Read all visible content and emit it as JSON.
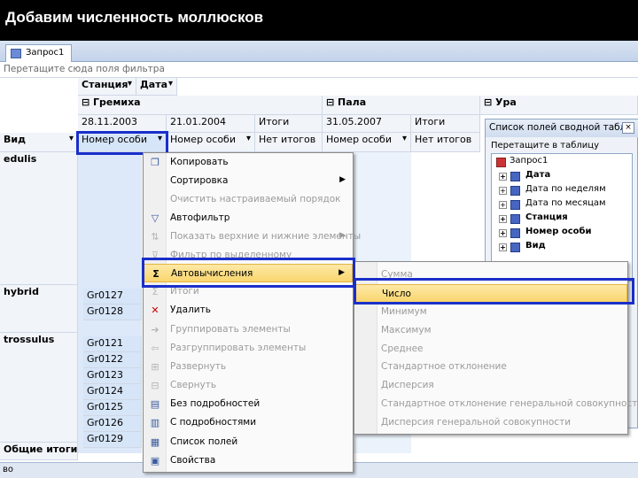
{
  "slide_title": "Добавим численность моллюсков",
  "tab": {
    "label": "Запрос1"
  },
  "filter_zone": "Перетащите сюда поля фильтра",
  "column_fields": {
    "station": "Станция",
    "date": "Дата"
  },
  "row_field": "Вид",
  "stations": [
    {
      "label": "⊟ Гремиха",
      "dates": [
        "28.11.2003",
        "21.01.2004"
      ],
      "totals": "Итоги"
    },
    {
      "label": "⊟ Пала",
      "dates": [
        "31.05.2007"
      ],
      "totals": "Итоги"
    },
    {
      "label": "⊟ Ура"
    }
  ],
  "data_headers": {
    "specimen": "Номер особи",
    "no_totals": "Нет итогов"
  },
  "rows": {
    "edulis": "edulis",
    "hybrid": "hybrid",
    "hybrid_items": [
      "Gr0127",
      "Gr0128"
    ],
    "trossulus": "trossulus",
    "trossulus_items": [
      "Gr0121",
      "Gr0122",
      "Gr0123",
      "Gr0124",
      "Gr0125",
      "Gr0126",
      "Gr0129"
    ],
    "grand_total": "Общие итоги"
  },
  "context_menu": [
    {
      "label": "Копировать",
      "icon": "copy-icon",
      "disabled": false
    },
    {
      "label": "Сортировка",
      "icon": "",
      "disabled": false,
      "submenu": true
    },
    {
      "label": "Очистить настраиваемый порядок",
      "icon": "",
      "disabled": true
    },
    {
      "label": "Автофильтр",
      "icon": "autofilter-icon",
      "disabled": false
    },
    {
      "label": "Показать верхние и нижние элементы",
      "icon": "top-bottom-icon",
      "disabled": true,
      "submenu": true
    },
    {
      "label": "Фильтр по выделенному",
      "icon": "filter-icon",
      "disabled": true
    },
    {
      "label": "Автовычисления",
      "icon": "sigma-icon",
      "disabled": false,
      "submenu": true
    },
    {
      "label": "Итоги",
      "icon": "subtotals-icon",
      "disabled": true
    },
    {
      "label": "Удалить",
      "icon": "delete-icon",
      "disabled": false
    },
    {
      "label": "Группировать элементы",
      "icon": "group-icon",
      "disabled": true
    },
    {
      "label": "Разгруппировать элементы",
      "icon": "ungroup-icon",
      "disabled": true
    },
    {
      "label": "Развернуть",
      "icon": "expand-icon",
      "disabled": true
    },
    {
      "label": "Свернуть",
      "icon": "collapse-icon",
      "disabled": true
    },
    {
      "label": "Без подробностей",
      "icon": "hide-details-icon",
      "disabled": false
    },
    {
      "label": "С подробностями",
      "icon": "show-details-icon",
      "disabled": false
    },
    {
      "label": "Список полей",
      "icon": "field-list-icon",
      "disabled": false
    },
    {
      "label": "Свойства",
      "icon": "properties-icon",
      "disabled": false
    }
  ],
  "submenu": [
    {
      "label": "Сумма",
      "disabled": true
    },
    {
      "label": "Число",
      "disabled": false,
      "highlighted": true
    },
    {
      "label": "Минимум",
      "disabled": true
    },
    {
      "label": "Максимум",
      "disabled": true
    },
    {
      "label": "Среднее",
      "disabled": true
    },
    {
      "label": "Стандартное отклонение",
      "disabled": true
    },
    {
      "label": "Дисперсия",
      "disabled": true
    },
    {
      "label": "Стандартное отклонение генеральной совокупности",
      "disabled": true
    },
    {
      "label": "Дисперсия генеральной совокупности",
      "disabled": true
    }
  ],
  "field_list": {
    "title": "Список полей сводной табл...",
    "close": "×",
    "hint": "Перетащите в таблицу",
    "root": "Запрос1",
    "fields": [
      "Дата",
      "Дата по неделям",
      "Дата по месяцам",
      "Станция",
      "Номер особи",
      "Вид"
    ],
    "bold_fields": [
      "Дата",
      "Станция",
      "Номер особи",
      "Вид"
    ]
  },
  "status": "во",
  "colors": {
    "highlight_box": "#1a2fc9",
    "selection": "#d6e5f7",
    "menu_highlight": "#fbe199"
  }
}
